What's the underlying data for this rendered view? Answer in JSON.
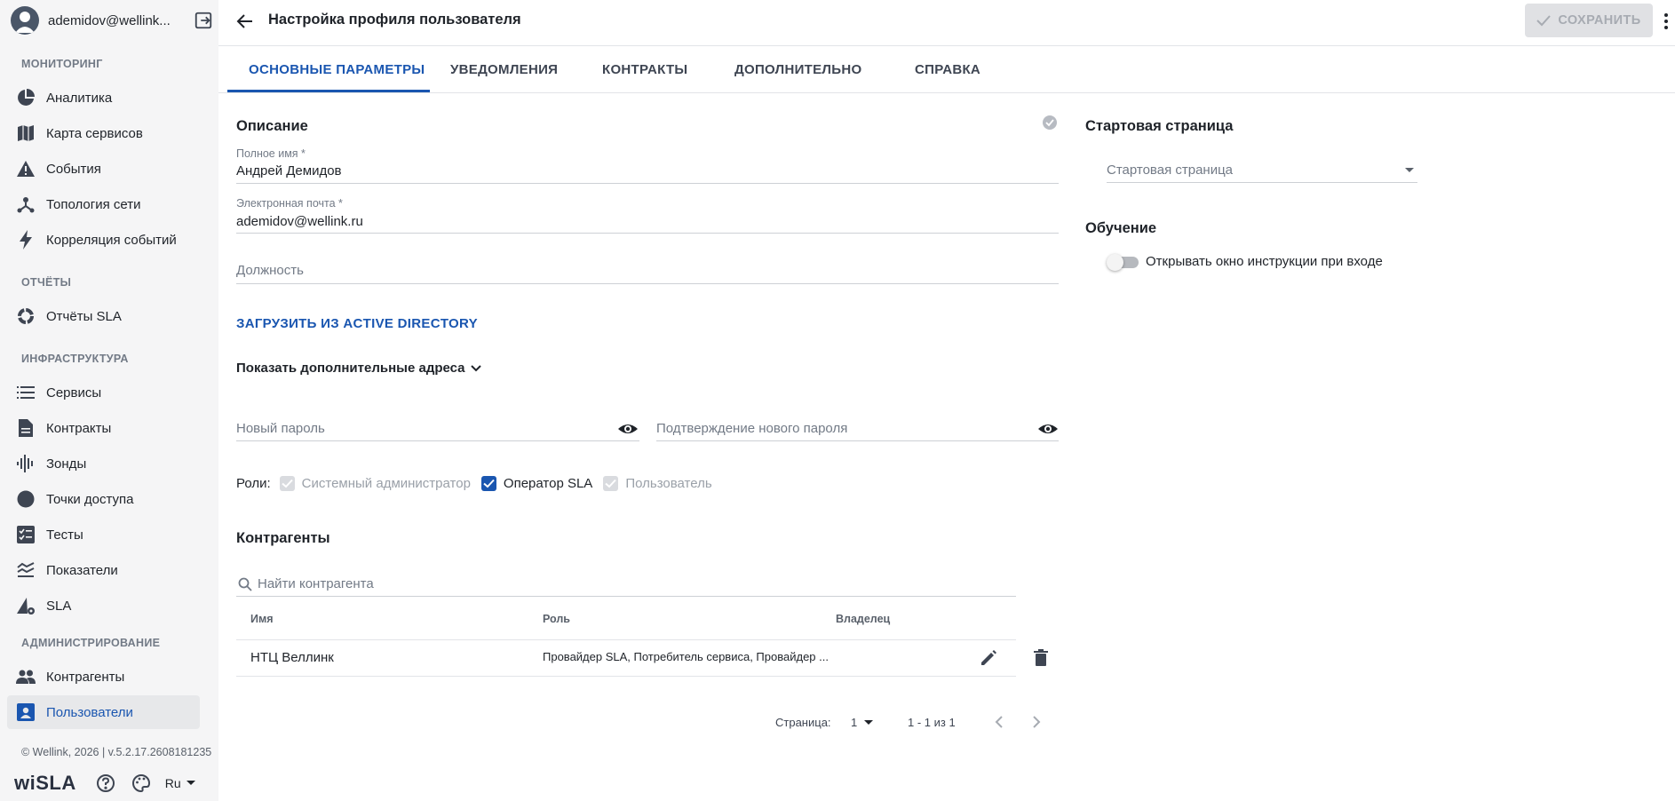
{
  "user": {
    "email_short": "ademidov@wellink..."
  },
  "sidebar": {
    "sections": {
      "monitoring": "МОНИТОРИНГ",
      "reports": "ОТЧЁТЫ",
      "infrastructure": "ИНФРАСТРУКТУРА",
      "administration": "АДМИНИСТРИРОВАНИЕ"
    },
    "items": {
      "analytics": "Аналитика",
      "service_map": "Карта сервисов",
      "events": "События",
      "topology": "Топология сети",
      "correlation": "Корреляция событий",
      "sla_reports": "Отчёты SLA",
      "services": "Сервисы",
      "contracts": "Контракты",
      "probes": "Зонды",
      "access_points": "Точки доступа",
      "tests": "Тесты",
      "indicators": "Показатели",
      "sla": "SLA",
      "counterparties": "Контрагенты",
      "users": "Пользователи"
    },
    "active_item": "users",
    "footer": {
      "copyright": "© Wellink, 2026 | v.5.2.17.2608181235",
      "logo": "wiSLA",
      "language": "Ru"
    }
  },
  "header": {
    "title": "Настройка профиля пользователя",
    "save_label": "СОХРАНИТЬ"
  },
  "tabs": {
    "main": "ОСНОВНЫЕ ПАРАМЕТРЫ",
    "notifications": "УВЕДОМЛЕНИЯ",
    "contracts": "КОНТРАКТЫ",
    "additional": "ДОПОЛНИТЕЛЬНО",
    "help": "СПРАВКА",
    "active": "main"
  },
  "form": {
    "description_title": "Описание",
    "full_name_label": "Полное имя *",
    "full_name_value": "Андрей Демидов",
    "email_label": "Электронная почта *",
    "email_value": "ademidov@wellink.ru",
    "position_placeholder": "Должность",
    "ad_button": "ЗАГРУЗИТЬ ИЗ ACTIVE DIRECTORY",
    "show_addresses": "Показать дополнительные адреса",
    "new_password_placeholder": "Новый пароль",
    "confirm_password_placeholder": "Подтверждение нового пароля",
    "roles_label": "Роли:",
    "roles": {
      "sysadmin": "Системный администратор",
      "sla_operator": "Оператор SLA",
      "user": "Пользователь"
    }
  },
  "counterparties": {
    "title": "Контрагенты",
    "search_placeholder": "Найти контрагента",
    "columns": {
      "name": "Имя",
      "role": "Роль",
      "owner": "Владелец"
    },
    "rows": [
      {
        "name": "НТЦ Веллинк",
        "role": "Провайдер SLA, Потребитель сервиса, Провайдер ...",
        "owner": ""
      }
    ],
    "pagination": {
      "page_label": "Страница:",
      "page_value": "1",
      "range": "1 - 1 из 1"
    }
  },
  "right_panel": {
    "start_page_title": "Стартовая страница",
    "start_page_placeholder": "Стартовая страница",
    "training_title": "Обучение",
    "training_toggle_label": "Открывать окно инструкции при входе"
  },
  "colors": {
    "accent": "#1a56b0",
    "sidebar_bg": "#f5f5f6",
    "icon": "#3e4552"
  }
}
